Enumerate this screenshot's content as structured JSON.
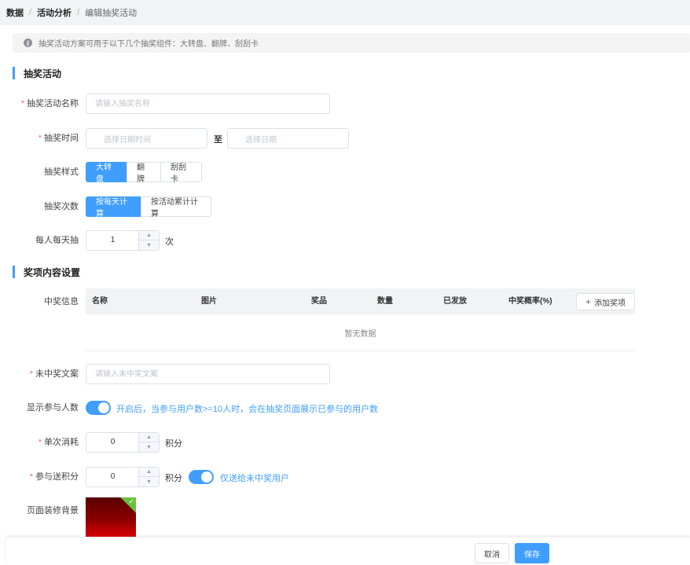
{
  "breadcrumb": {
    "items": [
      "数据",
      "活动分析"
    ],
    "current": "编辑抽奖活动",
    "separator": "/"
  },
  "notice": {
    "icon": "info-icon",
    "text": "抽奖活动方案可用于以下几个抽奖组件：大转盘、翻牌、刮刮卡"
  },
  "section1": {
    "title": "抽奖活动"
  },
  "activity_name": {
    "label": "抽奖活动名称",
    "placeholder": "请输入抽奖名称",
    "required": "*"
  },
  "draw_time": {
    "label": "抽奖时间",
    "required": "*",
    "start_placeholder": "选择日期时间",
    "to": "至",
    "end_placeholder": "选择日期"
  },
  "draw_style": {
    "label": "抽奖样式",
    "options": [
      "大转盘",
      "翻牌",
      "刮刮卡"
    ],
    "selected": "大转盘"
  },
  "draw_count": {
    "label": "抽奖次数",
    "options": [
      "按每天计算",
      "按活动累计计算"
    ],
    "selected": "按每天计算"
  },
  "daily_draw": {
    "label": "每人每天抽",
    "value": "1",
    "unit": "次"
  },
  "section2": {
    "title": "奖项内容设置"
  },
  "prize_info": {
    "label": "中奖信息",
    "columns": [
      "名称",
      "图片",
      "奖品",
      "数量",
      "已发放",
      "中奖概率(%)"
    ],
    "add_button": "添加奖项",
    "empty_text": "暂无数据"
  },
  "no_win_text": {
    "label": "未中奖文案",
    "placeholder": "请输入未中奖文案",
    "required": "*"
  },
  "show_participants": {
    "label": "显示参与人数",
    "enabled": true,
    "hint": "开启后，当参与用户数>=10人时，会在抽奖页面展示已参与的用户数"
  },
  "single_cost": {
    "label": "单次消耗",
    "required": "*",
    "value": "0",
    "unit": "积分"
  },
  "participate_points": {
    "label": "参与送积分",
    "required": "*",
    "value": "0",
    "unit": "积分",
    "switch_enabled": true,
    "switch_text": "仅送给未中奖用户"
  },
  "page_background": {
    "label": "页面装修背景"
  },
  "footer": {
    "cancel": "取消",
    "save": "保存"
  },
  "colors": {
    "primary": "#409eff",
    "required": "#f56c6c",
    "success": "#67c23a"
  }
}
